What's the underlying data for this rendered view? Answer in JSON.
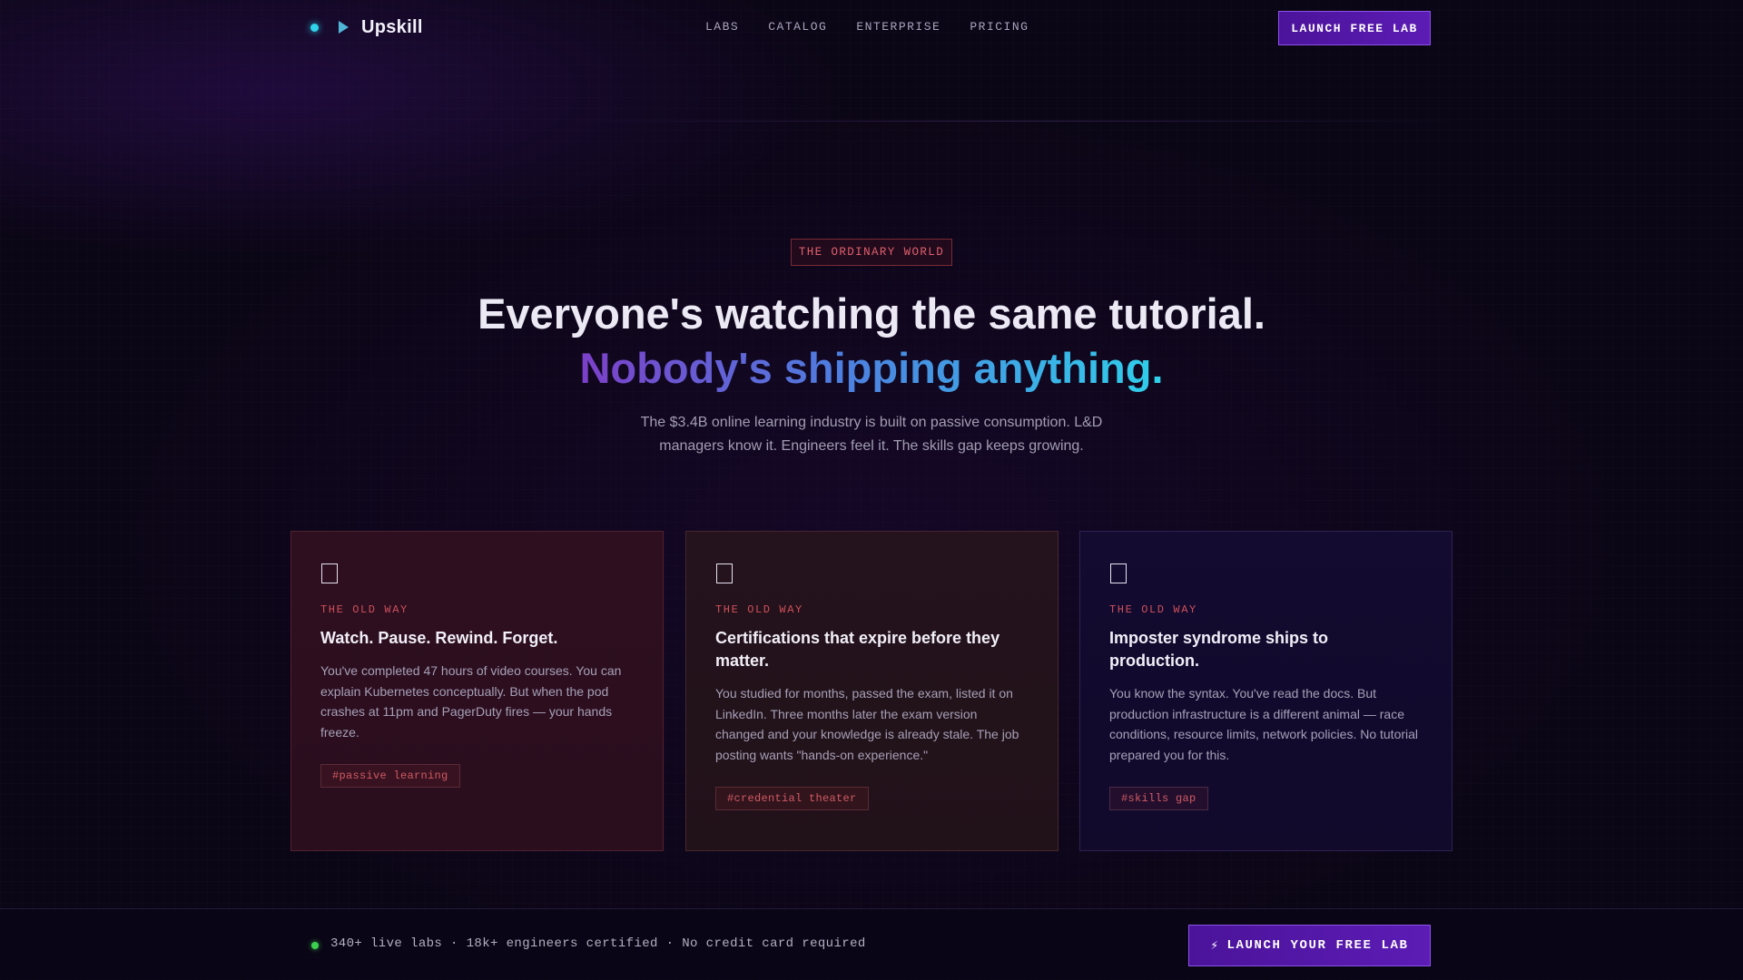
{
  "nav": {
    "brand": "Upskill",
    "links": [
      "LABS",
      "CATALOG",
      "ENTERPRISE",
      "PRICING"
    ],
    "cta": "LAUNCH FREE LAB"
  },
  "hero": {
    "eyebrow": "THE ORDINARY WORLD",
    "headline": "Everyone's watching the same tutorial.",
    "headline_accent": "Nobody's shipping anything.",
    "subtitle": "The $3.4B online learning industry is built on passive consumption. L&D managers know it. Engineers feel it. The skills gap keeps growing."
  },
  "cards": [
    {
      "kicker": "THE OLD WAY",
      "title": "Watch. Pause. Rewind. Forget.",
      "body": "You've completed 47 hours of video courses. You can explain Kubernetes conceptually. But when the pod crashes at 11pm and PagerDuty fires — your hands freeze.",
      "tag": "#passive learning"
    },
    {
      "kicker": "THE OLD WAY",
      "title": "Certifications that expire before they matter.",
      "body": "You studied for months, passed the exam, listed it on LinkedIn. Three months later the exam version changed and your knowledge is already stale. The job posting wants \"hands-on experience.\"",
      "tag": "#credential theater"
    },
    {
      "kicker": "THE OLD WAY",
      "title": "Imposter syndrome ships to production.",
      "body": "You know the syntax. You've read the docs. But production infrastructure is a different animal — race conditions, resource limits, network policies. No tutorial prepared you for this.",
      "tag": "#skills gap"
    }
  ],
  "bottom_bar": {
    "stats": "340+ live labs · 18k+ engineers certified · No credit card required",
    "cta_icon": "⚡",
    "cta": "LAUNCH YOUR FREE LAB"
  },
  "colors": {
    "background": "#0b0616",
    "accent_purple": "#5c1cb5",
    "accent_cyan": "#2fd0ea",
    "warning_red": "#d0505a",
    "status_green": "#3ccf4e"
  }
}
